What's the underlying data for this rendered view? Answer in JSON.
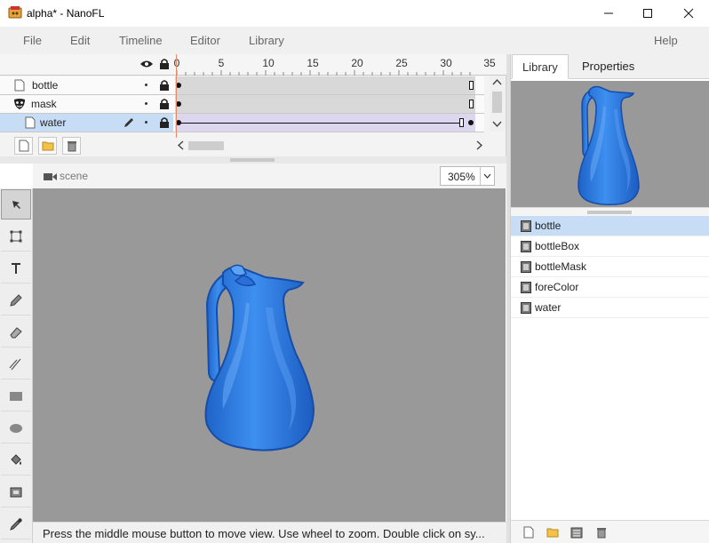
{
  "window": {
    "title": "alpha* - NanoFL"
  },
  "menu": {
    "items": [
      "File",
      "Edit",
      "Timeline",
      "Editor",
      "Library"
    ],
    "help": "Help"
  },
  "timeline": {
    "ruler_ticks": [
      "0",
      "5",
      "10",
      "15",
      "20",
      "25",
      "30",
      "35"
    ],
    "layers": [
      {
        "name": "bottle",
        "icon": "layer-icon",
        "selected": false
      },
      {
        "name": "mask",
        "icon": "mask-icon",
        "selected": false
      },
      {
        "name": "water",
        "icon": "layer-icon",
        "selected": true
      }
    ],
    "buttons": [
      "new-layer-icon",
      "new-folder-icon",
      "trash-icon"
    ]
  },
  "stage": {
    "scene_label": "scene",
    "zoom": "305%",
    "status": "Press the middle mouse button to move view. Use wheel to zoom. Double click on sy..."
  },
  "tools": [
    "select-arrow-icon",
    "transform-icon",
    "text-icon",
    "pencil-icon",
    "eraser-icon",
    "line-icon",
    "rectangle-icon",
    "ellipse-icon",
    "paint-bucket-icon",
    "gradient-icon",
    "eyedropper-icon"
  ],
  "right_panel": {
    "tabs": [
      "Library",
      "Properties"
    ],
    "active_tab": "Library",
    "library_items": [
      {
        "label": "bottle",
        "selected": true
      },
      {
        "label": "bottleBox",
        "selected": false
      },
      {
        "label": "bottleMask",
        "selected": false
      },
      {
        "label": "foreColor",
        "selected": false
      },
      {
        "label": "water",
        "selected": false
      }
    ],
    "toolbar": [
      "new-file-icon",
      "new-folder-icon",
      "properties-icon",
      "trash-icon"
    ]
  },
  "colors": {
    "canvas": "#999999",
    "bottle_blue": "#2f7fe0",
    "selection": "#c7dcf5"
  }
}
